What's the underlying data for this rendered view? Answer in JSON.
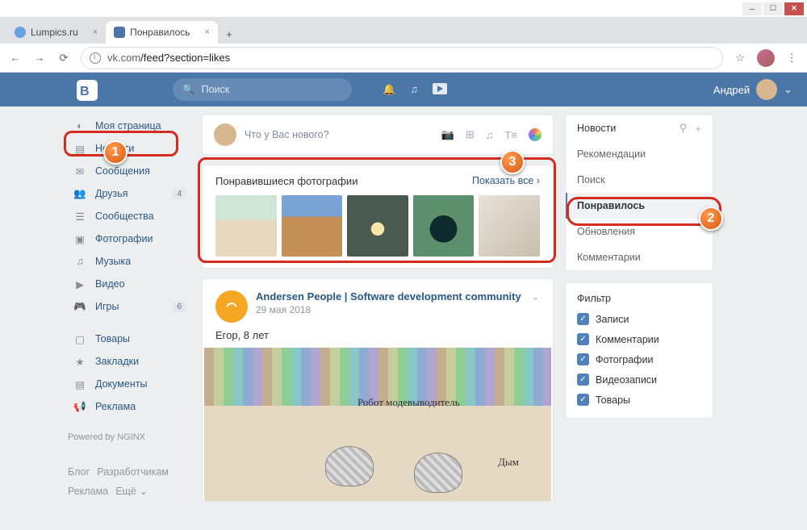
{
  "window": {
    "btn_min": "─",
    "btn_max": "☐",
    "btn_close": "✕"
  },
  "browser": {
    "tabs": [
      {
        "title": "Lumpics.ru"
      },
      {
        "title": "Понравилось"
      }
    ],
    "new_tab": "+",
    "back": "←",
    "fwd": "→",
    "reload": "⟳",
    "url_host": "vk.com",
    "url_path": "/feed?section=likes",
    "star": "☆",
    "menu": "⋮"
  },
  "vk": {
    "search_placeholder": "Поиск",
    "username": "Андрей",
    "caret": "⌄"
  },
  "nav": {
    "items": [
      {
        "icon": "◐",
        "label": "Моя страница",
        "badge": ""
      },
      {
        "icon": "▤",
        "label": "Новости",
        "badge": ""
      },
      {
        "icon": "✉",
        "label": "Сообщения",
        "badge": ""
      },
      {
        "icon": "👥",
        "label": "Друзья",
        "badge": "4"
      },
      {
        "icon": "☰",
        "label": "Сообщества",
        "badge": ""
      },
      {
        "icon": "▣",
        "label": "Фотографии",
        "badge": ""
      },
      {
        "icon": "♫",
        "label": "Музыка",
        "badge": ""
      },
      {
        "icon": "▶",
        "label": "Видео",
        "badge": ""
      },
      {
        "icon": "🎮",
        "label": "Игры",
        "badge": "6"
      }
    ],
    "items2": [
      {
        "icon": "▢",
        "label": "Товары"
      },
      {
        "icon": "★",
        "label": "Закладки"
      },
      {
        "icon": "▤",
        "label": "Документы"
      },
      {
        "icon": "📢",
        "label": "Реклама"
      }
    ],
    "powered": "Powered by NGINX",
    "footer": {
      "a": "Блог",
      "b": "Разработчикам",
      "c": "Реклама",
      "d": "Ещё ⌄"
    }
  },
  "composer": {
    "placeholder": "Что у Вас нового?",
    "i_photo": "📷",
    "i_video": "⊞",
    "i_music": "♫",
    "i_text": "T≡"
  },
  "liked_block": {
    "title": "Понравившиеся фотографии",
    "show_all": "Показать все  ›"
  },
  "post": {
    "author": "Andersen People | Software development community",
    "date": "29 мая 2018",
    "more": "⌄",
    "text": "Егор, 8 лет",
    "label1": "Робот\nмодевыводитель",
    "label2": "Дым"
  },
  "rside": {
    "head": "Новости",
    "filter_ico": "⚲",
    "plus_ico": "+",
    "items": [
      "Рекомендации",
      "Поиск",
      "Понравилось",
      "Обновления",
      "Комментарии"
    ]
  },
  "filter": {
    "title": "Фильтр",
    "opts": [
      "Записи",
      "Комментарии",
      "Фотографии",
      "Видеозаписи",
      "Товары"
    ]
  },
  "annot": {
    "n1": "1",
    "n2": "2",
    "n3": "3"
  }
}
